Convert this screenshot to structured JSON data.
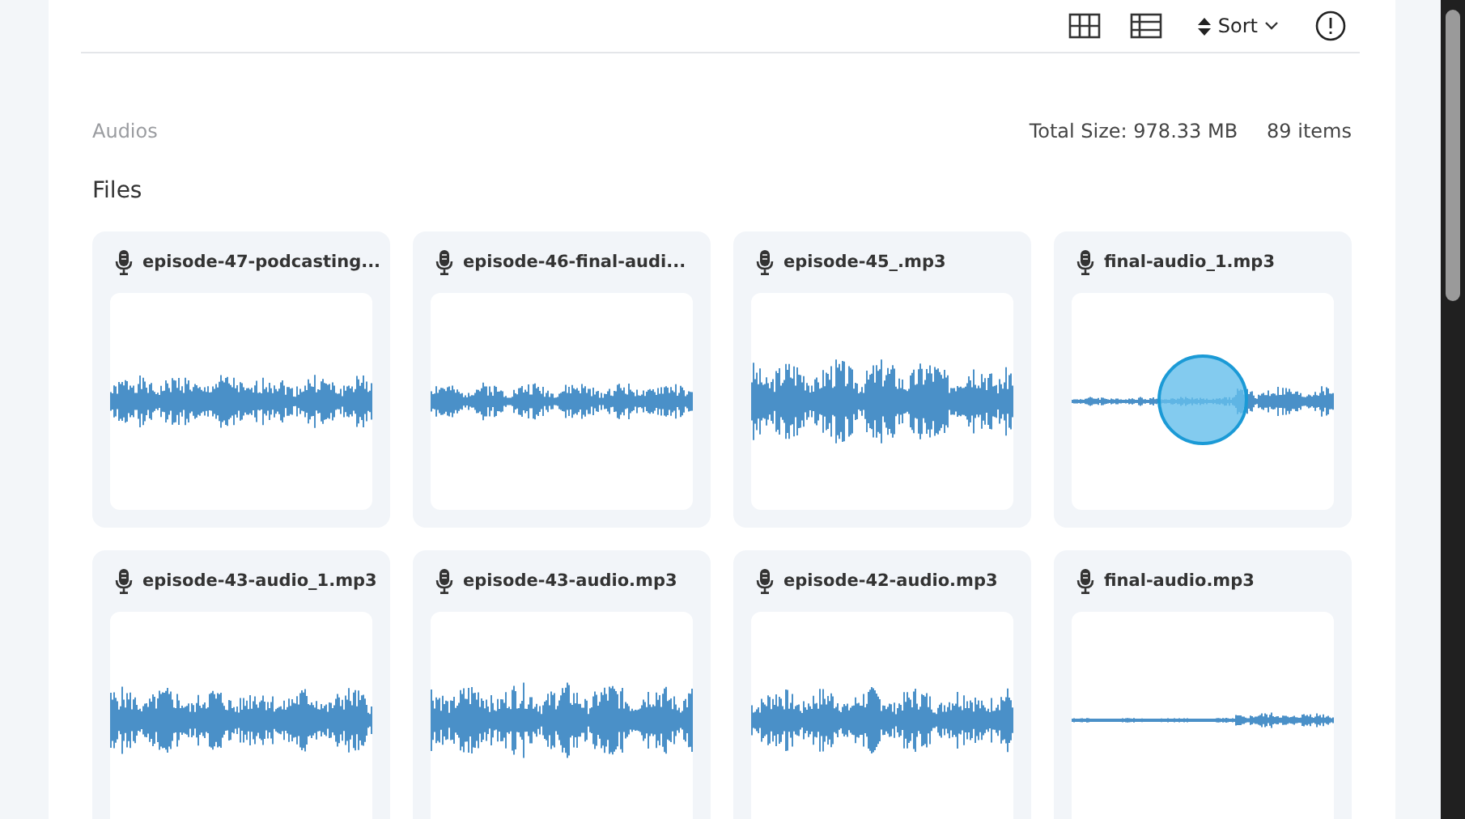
{
  "toolbar": {
    "sort_label": "Sort"
  },
  "section": {
    "title": "Audios",
    "total_size": "Total Size: 978.33 MB",
    "item_count": "89 items"
  },
  "files_heading": "Files",
  "files": [
    {
      "name": "episode-47-podcasting...",
      "highlighted": false
    },
    {
      "name": "episode-46-final-audi...",
      "highlighted": false
    },
    {
      "name": "episode-45_.mp3",
      "highlighted": false
    },
    {
      "name": "final-audio_1.mp3",
      "highlighted": true
    },
    {
      "name": "episode-43-audio_1.mp3",
      "highlighted": false
    },
    {
      "name": "episode-43-audio.mp3",
      "highlighted": false
    },
    {
      "name": "episode-42-audio.mp3",
      "highlighted": false
    },
    {
      "name": "final-audio.mp3",
      "highlighted": false
    }
  ]
}
